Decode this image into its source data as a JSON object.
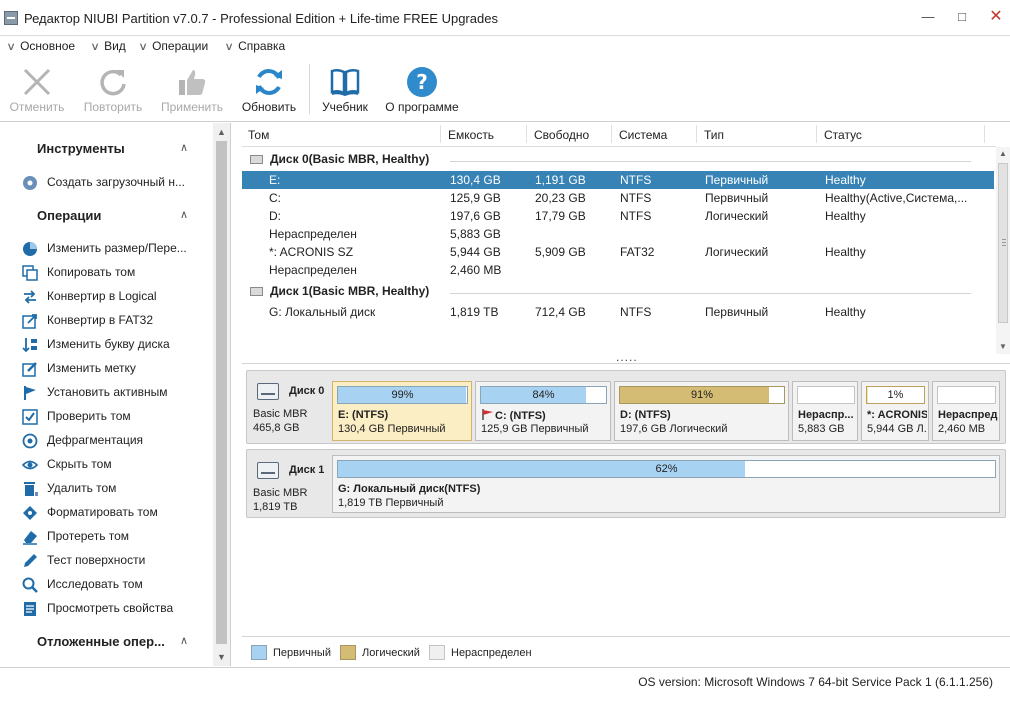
{
  "window": {
    "title": "Редактор NIUBI Partition v7.0.7 - Professional Edition + Life-time FREE Upgrades",
    "min_icon": "minimize-icon",
    "max_icon": "maximize-icon",
    "close_icon": "close-icon"
  },
  "menu": {
    "items": [
      "Основное",
      "Вид",
      "Операции",
      "Справка"
    ]
  },
  "toolbar": {
    "undo": "Отменить",
    "redo": "Повторить",
    "apply": "Применить",
    "refresh": "Обновить",
    "tutorial": "Учебник",
    "about": "О программе"
  },
  "left_panel": {
    "tools_title": "Инструменты",
    "tools_items": [
      "Создать загрузочный н..."
    ],
    "ops_title": "Операции",
    "ops_items": [
      "Изменить размер/Пере...",
      "Копировать том",
      "Конвертир в Logical",
      "Конвертир в FAT32",
      "Изменить букву диска",
      "Изменить метку",
      "Установить активным",
      "Проверить том",
      "Дефрагментация",
      "Скрыть том",
      "Удалить том",
      "Форматировать том",
      "Протереть том",
      "Тест поверхности",
      "Исследовать том",
      "Просмотреть свойства"
    ],
    "pending_title": "Отложенные опер..."
  },
  "table": {
    "columns": [
      "Том",
      "Емкость",
      "Свободно",
      "Система",
      "Тип",
      "Статус"
    ],
    "groups": [
      {
        "label": "Диск 0(Basic MBR, Healthy)",
        "rows": [
          [
            "E:",
            "130,4 GB",
            "1,191 GB",
            "NTFS",
            "Первичный",
            "Healthy"
          ],
          [
            "C:",
            "125,9 GB",
            "20,23 GB",
            "NTFS",
            "Первичный",
            "Healthy(Active,Система,..."
          ],
          [
            "D:",
            "197,6 GB",
            "17,79 GB",
            "NTFS",
            "Логический",
            "Healthy"
          ],
          [
            "Нераспределен",
            "5,883 GB",
            "",
            "",
            "",
            ""
          ],
          [
            "*: ACRONIS SZ",
            "5,944 GB",
            "5,909 GB",
            "FAT32",
            "Логический",
            "Healthy"
          ],
          [
            "Нераспределен",
            "2,460 MB",
            "",
            "",
            "",
            ""
          ]
        ]
      },
      {
        "label": "Диск 1(Basic MBR, Healthy)",
        "rows": [
          [
            "G: Локальный диск",
            "1,819 TB",
            "712,4 GB",
            "NTFS",
            "Первичный",
            "Healthy"
          ]
        ]
      }
    ],
    "more": "....."
  },
  "disks": [
    {
      "name": "Диск 0",
      "type": "Basic MBR",
      "size": "465,8 GB",
      "partitions": [
        {
          "pct_label": "99%",
          "fill": 0.99,
          "name": "E: (NTFS)",
          "detail": "130,4 GB Первичный",
          "kind": "primary",
          "selected": true
        },
        {
          "pct_label": "84%",
          "fill": 0.84,
          "name": "C: (NTFS)",
          "detail": "125,9 GB Первичный",
          "kind": "primary",
          "flag": true
        },
        {
          "pct_label": "91%",
          "fill": 0.91,
          "name": "D: (NTFS)",
          "detail": "197,6 GB Логический",
          "kind": "logical"
        },
        {
          "pct_label": "",
          "fill": 0,
          "name": "Нераспр...",
          "detail": "5,883 GB",
          "kind": "unalloc"
        },
        {
          "pct_label": "1%",
          "fill": 0.01,
          "name": "*: ACRONIS SZ",
          "detail": "5,944 GB Л...",
          "kind": "fat"
        },
        {
          "pct_label": "",
          "fill": 0,
          "name": "Нераспред...",
          "detail": "2,460 MB",
          "kind": "unalloc"
        }
      ]
    },
    {
      "name": "Диск 1",
      "type": "Basic MBR",
      "size": "1,819 TB",
      "partitions": [
        {
          "pct_label": "62%",
          "fill": 0.62,
          "name": "G: Локальный диск(NTFS)",
          "detail": "1,819 TB Первичный",
          "kind": "primary"
        }
      ]
    }
  ],
  "legend": {
    "primary": "Первичный",
    "logical": "Логический",
    "unalloc": "Нераспределен"
  },
  "colors": {
    "selection": "#3883b6",
    "primary_fill": "#a8d2f2",
    "logical_fill": "#d4bc74",
    "refresh_icon": "#2a86c8"
  },
  "status": {
    "text": "OS version: Microsoft Windows 7  64-bit Service Pack 1 (6.1.1.256)"
  }
}
